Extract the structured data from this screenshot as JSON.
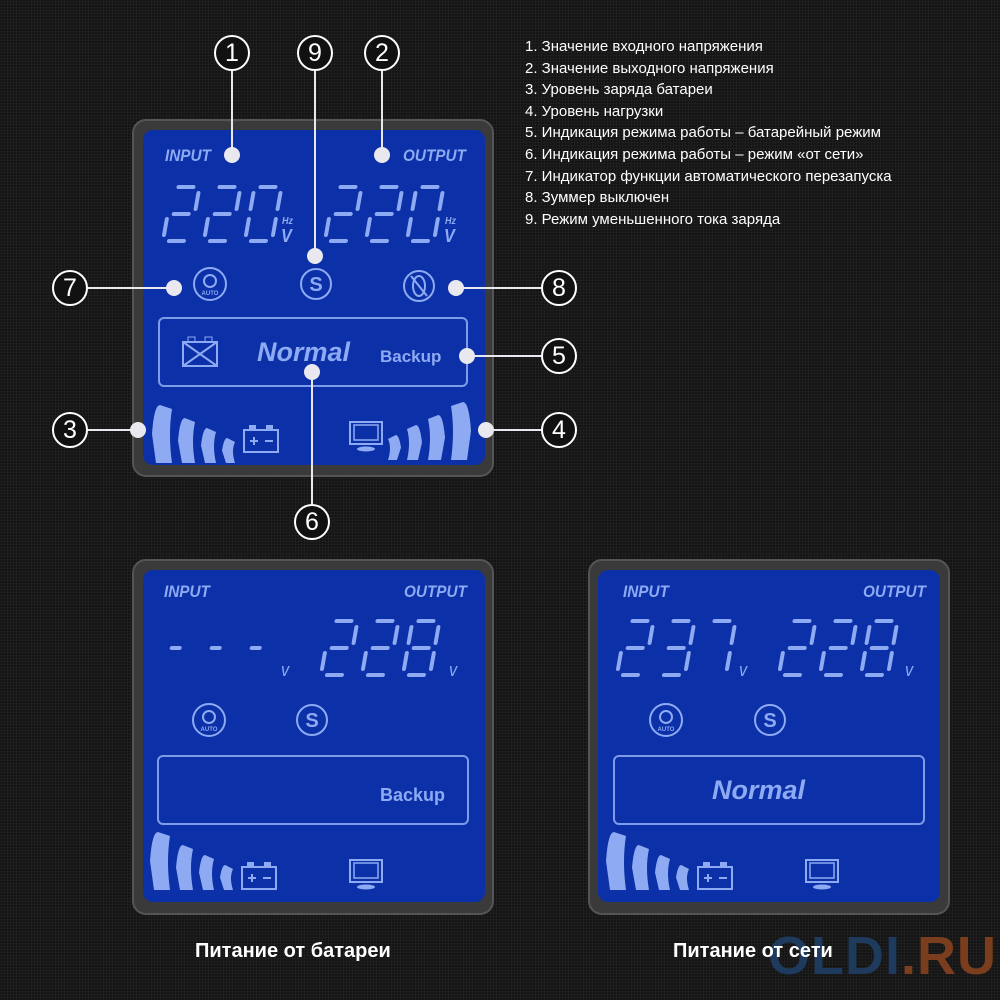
{
  "legend": [
    "1. Значение входного напряжения",
    "2. Значение выходного напряжения",
    "3. Уровень заряда батареи",
    "4. Уровень нагрузки",
    "5. Индикация режима работы – батарейный режим",
    "6. Индикация режима работы – режим «от сети»",
    "7. Индикатор функции автоматического перезапуска",
    "8. Зуммер выключен",
    "9. Режим уменьшенного тока заряда"
  ],
  "callouts": [
    "1",
    "2",
    "3",
    "4",
    "5",
    "6",
    "7",
    "8",
    "9"
  ],
  "top_panel": {
    "input_label": "INPUT",
    "output_label": "OUTPUT",
    "input_value": "220",
    "output_value": "220",
    "unit_hz": "Hz",
    "unit_v": "V",
    "mode_normal": "Normal",
    "mode_backup": "Backup",
    "auto_label": "AUTO",
    "s_label": "S"
  },
  "battery_panel": {
    "input_label": "INPUT",
    "output_label": "OUTPUT",
    "input_value": "---",
    "output_value": "228",
    "unit_v": "v",
    "mode": "Backup",
    "auto_label": "AUTO",
    "s_label": "S",
    "caption": "Питание от батареи"
  },
  "mains_panel": {
    "input_label": "INPUT",
    "output_label": "OUTPUT",
    "input_value": "237",
    "output_value": "228",
    "unit_v": "v",
    "mode": "Normal",
    "auto_label": "AUTO",
    "s_label": "S",
    "caption": "Питание от сети"
  },
  "watermark": {
    "part1": "OLDI",
    "part2": ".RU"
  },
  "colors": {
    "lcd": "#0b30a8",
    "segment": "#8eaaf2",
    "watermark_blue": "#1e3a5c",
    "watermark_orange": "#7a3e1e"
  }
}
